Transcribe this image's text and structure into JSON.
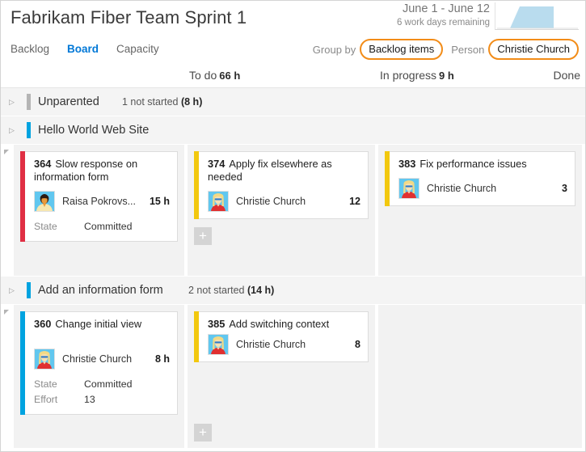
{
  "header": {
    "title": "Fabrikam Fiber Team Sprint 1",
    "tabs": [
      {
        "label": "Backlog",
        "active": false
      },
      {
        "label": "Board",
        "active": true
      },
      {
        "label": "Capacity",
        "active": false
      }
    ],
    "sprint_range": "June 1 - June 12",
    "sprint_remaining": "6 work days remaining",
    "burndown_color": "#b9dcee"
  },
  "filters": {
    "group_by_label": "Group by",
    "group_by_value": "Backlog items",
    "person_label": "Person",
    "person_value": "Christie Church",
    "highlight_color": "#f28c18"
  },
  "columns": {
    "todo_label": "To do",
    "todo_hours": "66 h",
    "inprogress_label": "In progress",
    "inprogress_hours": "9 h",
    "done_label": "Done"
  },
  "groups": [
    {
      "title": "Unparented",
      "color": "#b4b4b4",
      "meta_count": "1 not started ",
      "meta_hours": "(8 h)",
      "expanded": false
    },
    {
      "title": "Hello World Web Site",
      "color": "#00a3e0",
      "meta_count": "",
      "meta_hours": "",
      "expanded": true
    },
    {
      "title": "Add an information form",
      "color": "#00a3e0",
      "meta_count": "2 not started ",
      "meta_hours": "(14 h)",
      "expanded": true
    }
  ],
  "lanes": [
    {
      "todo": [
        {
          "id": "364",
          "title": "Slow response on information form",
          "strip_color": "#e02f44",
          "assignee": "Raisa Pokrovs...",
          "avatar": "dark-hair-avatar",
          "remaining": "15 h",
          "fields": [
            {
              "label": "State",
              "value": "Committed"
            }
          ]
        }
      ],
      "todo_add": "+",
      "inprogress": [
        {
          "id": "374",
          "title": "Apply fix elsewhere as needed",
          "strip_color": "#f2c80f",
          "assignee": "Christie Church",
          "avatar": "blonde-avatar",
          "remaining": "12",
          "fields": []
        }
      ],
      "inprogress_add": "+",
      "done": [
        {
          "id": "383",
          "title": "Fix performance issues",
          "strip_color": "#f2c80f",
          "assignee": "Christie Church",
          "avatar": "blonde-avatar",
          "remaining": "3",
          "fields": []
        }
      ]
    },
    {
      "todo": [
        {
          "id": "360",
          "title": "Change initial view",
          "strip_color": "#00a3e0",
          "assignee": "Christie Church",
          "avatar": "blonde-avatar",
          "remaining": "8 h",
          "fields": [
            {
              "label": "State",
              "value": "Committed"
            },
            {
              "label": "Effort",
              "value": "13"
            }
          ]
        }
      ],
      "todo_add": "",
      "inprogress": [
        {
          "id": "385",
          "title": "Add switching context",
          "strip_color": "#f2c80f",
          "assignee": "Christie Church",
          "avatar": "blonde-avatar",
          "remaining": "8",
          "fields": []
        }
      ],
      "inprogress_add": "+",
      "done": []
    }
  ]
}
